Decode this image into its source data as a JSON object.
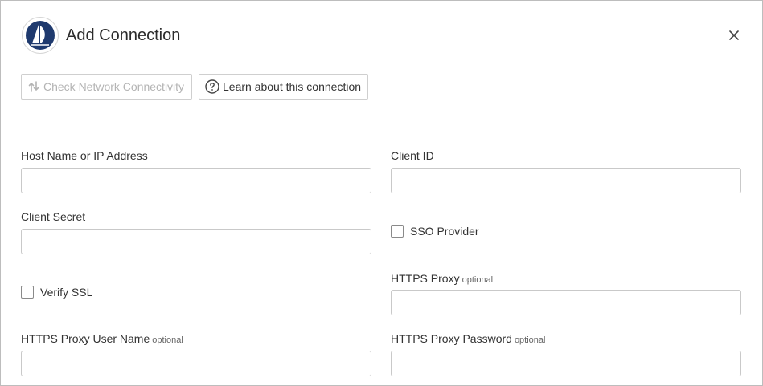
{
  "dialog": {
    "title": "Add Connection",
    "logo_icon": "sailboat-logo-icon",
    "close_icon": "close-icon"
  },
  "toolbar": {
    "check_label": "Check Network Connectivity",
    "check_icon": "network-check-icon",
    "check_disabled": true,
    "learn_label": "Learn about this connection",
    "learn_icon": "help-circle-icon"
  },
  "form": {
    "host": {
      "label": "Host Name or IP Address",
      "value": ""
    },
    "client_id": {
      "label": "Client ID",
      "value": ""
    },
    "client_secret": {
      "label": "Client Secret",
      "value": ""
    },
    "sso_provider": {
      "label": "SSO Provider",
      "checked": false
    },
    "verify_ssl": {
      "label": "Verify SSL",
      "checked": false
    },
    "https_proxy": {
      "label": "HTTPS Proxy",
      "optional": "optional",
      "value": ""
    },
    "proxy_user": {
      "label": "HTTPS Proxy User Name",
      "optional": "optional",
      "value": ""
    },
    "proxy_password": {
      "label": "HTTPS Proxy Password",
      "optional": "optional",
      "value": ""
    }
  },
  "colors": {
    "logo_navy": "#1f3a6e",
    "border": "#c9c9c9",
    "disabled_text": "#b4b4b4"
  }
}
